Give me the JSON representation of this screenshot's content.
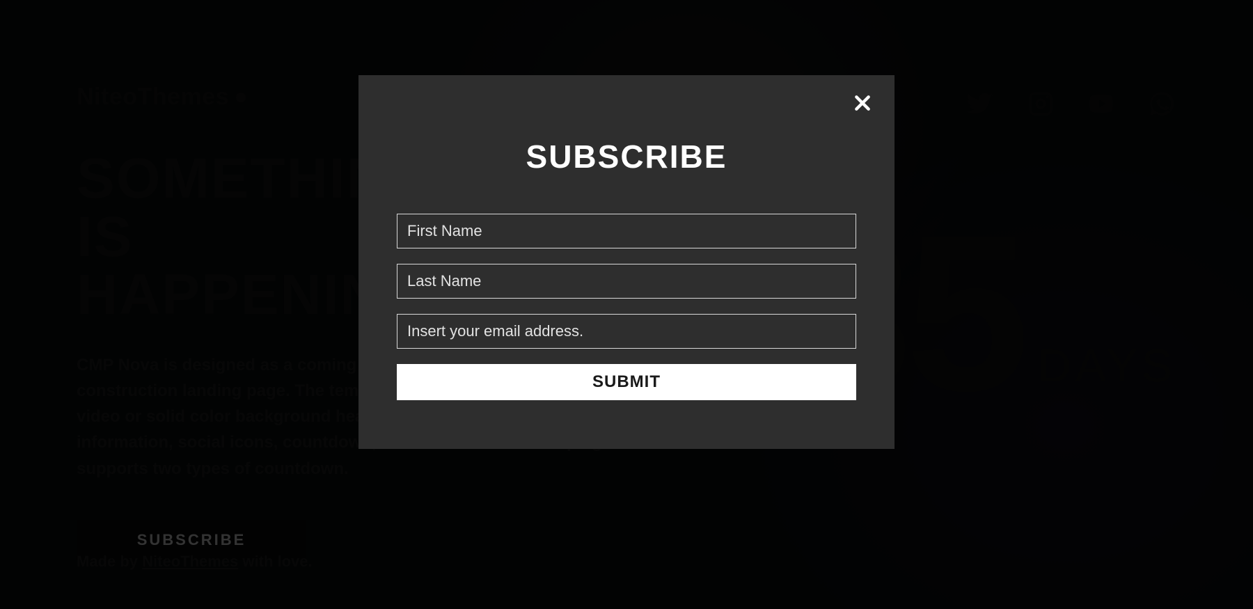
{
  "brand": {
    "name": "NiteoThemes"
  },
  "hero": {
    "title_line1": "SOMETHING BIG IS",
    "title_line2": "HAPPENING",
    "description": "CMP Nova is designed as a coming soon template or under construction landing page. The template is styled with picture, video or solid color background header with your company information, social icons, countdown, or subscribe form. The plugin supports two types of countdown.",
    "subscribe_label": "SUBSCRIBE"
  },
  "countdown": {
    "value": "35",
    "unit": "DAYS"
  },
  "footer": {
    "prefix": "Made by ",
    "link_text": "NiteoThemes",
    "suffix": " with love."
  },
  "socials": {
    "items": [
      {
        "name": "twitter-icon"
      },
      {
        "name": "instagram-icon"
      },
      {
        "name": "youtube-icon"
      },
      {
        "name": "whatsapp-icon"
      }
    ]
  },
  "modal": {
    "title": "SUBSCRIBE",
    "first_name_placeholder": "First Name",
    "last_name_placeholder": "Last Name",
    "email_placeholder": "Insert your email address.",
    "submit_label": "SUBMIT"
  }
}
